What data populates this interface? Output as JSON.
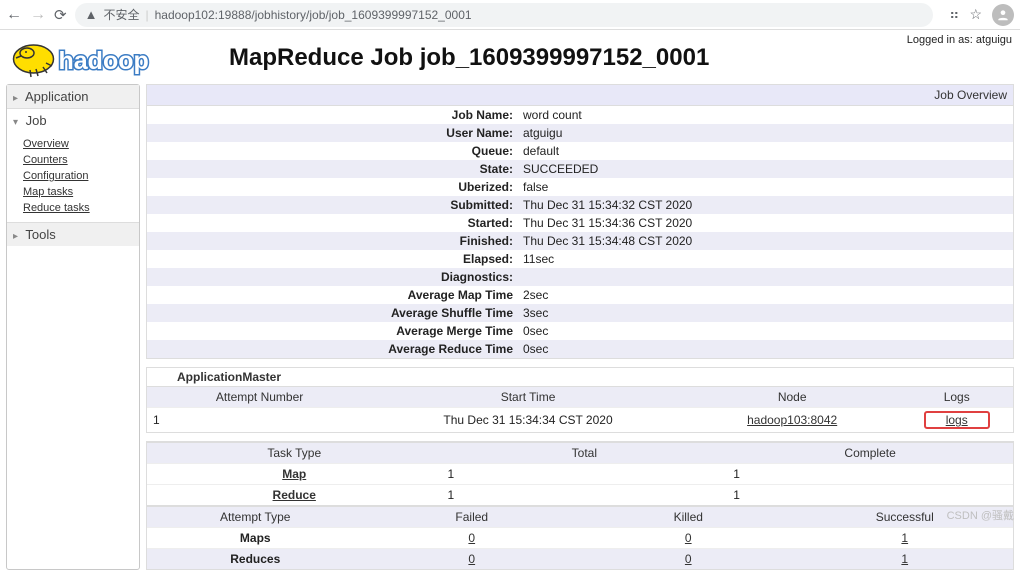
{
  "browser": {
    "insecure_label": "不安全",
    "url": "hadoop102:19888/jobhistory/job/job_1609399997152_0001"
  },
  "login": {
    "text": "Logged in as: atguigu"
  },
  "title": "MapReduce Job job_1609399997152_0001",
  "sidebar": {
    "application": "Application",
    "job": "Job",
    "job_items": [
      "Overview",
      "Counters",
      "Configuration",
      "Map tasks",
      "Reduce tasks"
    ],
    "tools": "Tools"
  },
  "overview": {
    "heading": "Job Overview",
    "rows": [
      {
        "k": "Job Name:",
        "v": "word count"
      },
      {
        "k": "User Name:",
        "v": "atguigu"
      },
      {
        "k": "Queue:",
        "v": "default"
      },
      {
        "k": "State:",
        "v": "SUCCEEDED"
      },
      {
        "k": "Uberized:",
        "v": "false"
      },
      {
        "k": "Submitted:",
        "v": "Thu Dec 31 15:34:32 CST 2020"
      },
      {
        "k": "Started:",
        "v": "Thu Dec 31 15:34:36 CST 2020"
      },
      {
        "k": "Finished:",
        "v": "Thu Dec 31 15:34:48 CST 2020"
      },
      {
        "k": "Elapsed:",
        "v": "11sec"
      },
      {
        "k": "Diagnostics:",
        "v": ""
      },
      {
        "k": "Average Map Time",
        "v": "2sec"
      },
      {
        "k": "Average Shuffle Time",
        "v": "3sec"
      },
      {
        "k": "Average Merge Time",
        "v": "0sec"
      },
      {
        "k": "Average Reduce Time",
        "v": "0sec"
      }
    ]
  },
  "appmaster": {
    "title": "ApplicationMaster",
    "headers": [
      "Attempt Number",
      "Start Time",
      "Node",
      "Logs"
    ],
    "row": {
      "attempt": "1",
      "start": "Thu Dec 31 15:34:34 CST 2020",
      "node": "hadoop103:8042",
      "logs": "logs"
    }
  },
  "tasks": {
    "headers": [
      "Task Type",
      "Total",
      "Complete"
    ],
    "rows": [
      {
        "type": "Map",
        "total": "1",
        "complete": "1"
      },
      {
        "type": "Reduce",
        "total": "1",
        "complete": "1"
      }
    ]
  },
  "attempts": {
    "headers": [
      "Attempt Type",
      "Failed",
      "Killed",
      "Successful"
    ],
    "rows": [
      {
        "type": "Maps",
        "failed": "0",
        "killed": "0",
        "successful": "1"
      },
      {
        "type": "Reduces",
        "failed": "0",
        "killed": "0",
        "successful": "1"
      }
    ]
  },
  "watermark": "CSDN @骚戴"
}
